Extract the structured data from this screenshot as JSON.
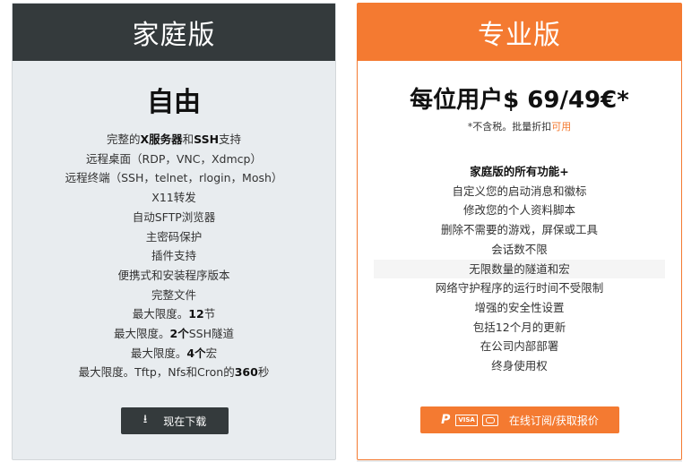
{
  "home": {
    "title": "家庭版",
    "price": "自由",
    "features": [
      {
        "pre": "完整的",
        "bold": "X服务器",
        "mid": "和",
        "bold2": "SSH",
        "post": "支持"
      },
      {
        "pre": "远程桌面（RDP，VNC，Xdmcp）"
      },
      {
        "pre": "远程终端（SSH，telnet，rlogin，Mosh）"
      },
      {
        "pre": "X11转发"
      },
      {
        "pre": "自动SFTP浏览器"
      },
      {
        "pre": "主密码保护"
      },
      {
        "pre": "插件支持"
      },
      {
        "pre": "便携式和安装程序版本"
      },
      {
        "pre": "完整文件"
      },
      {
        "pre": "最大限度。",
        "bold": "12",
        "mid": "节"
      },
      {
        "pre": "最大限度。",
        "bold": "2个",
        "mid": "SSH隧道"
      },
      {
        "pre": "最大限度。",
        "bold": "4个",
        "mid": "宏"
      },
      {
        "pre": "最大限度。Tftp，Nfs和Cron的",
        "bold": "360",
        "mid": "秒"
      }
    ],
    "download_label": "现在下载",
    "download_icon": "download-icon"
  },
  "pro": {
    "title": "专业版",
    "price": "每位用户$ 69/49€*",
    "note_pre": "*不含税。批量折扣",
    "note_link": "可用",
    "features_header": "家庭版的所有功能+",
    "features": [
      "自定义您的启动消息和徽标",
      "修改您的个人资料脚本",
      "删除不需要的游戏，屏保或工具",
      "会话数不限",
      "无限数量的隧道和宏",
      "网络守护程序的运行时间不受限制",
      "增强的安全性设置",
      "包括12个月的更新",
      "在公司内部部署",
      "终身使用权"
    ],
    "buy_label": "在线订阅/获取报价",
    "pay_icons": [
      "paypal-icon",
      "visa-icon",
      "mastercard-icon"
    ],
    "visa_text": "VISA"
  },
  "colors": {
    "accent": "#f47a31",
    "dark": "#343a3c",
    "panel": "#e8ecef"
  }
}
